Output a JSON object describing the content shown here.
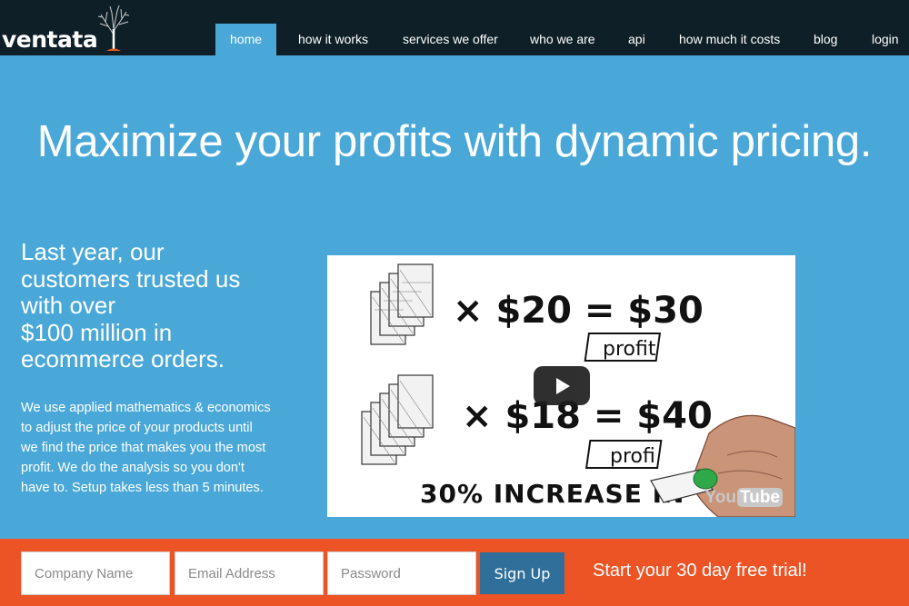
{
  "brand": {
    "name": "ventata"
  },
  "nav": {
    "items": [
      {
        "label": "home",
        "active": true
      },
      {
        "label": "how it works"
      },
      {
        "label": "services we offer"
      },
      {
        "label": "who we are"
      },
      {
        "label": "api"
      },
      {
        "label": "how much it costs"
      },
      {
        "label": "blog"
      },
      {
        "label": "login"
      }
    ]
  },
  "hero": {
    "headline": "Maximize your profits with dynamic pricing.",
    "stat_lines": [
      "Last year, our",
      "customers trusted us",
      "with over",
      "$100 million in",
      "ecommerce orders."
    ],
    "description": "We use applied mathematics & economics to adjust the price of your products until we find the price that makes you the most profit. We do the analysis so you don't have to. Setup takes less than 5 minutes."
  },
  "video": {
    "line1_mult": "× $20 = $30",
    "line1_label": "profit",
    "line2_mult": "× $18 = $40",
    "line2_label": "profi",
    "bottom_text": "30% INCREASE IN",
    "yt_you": "You",
    "yt_tube": "Tube",
    "play_icon": "play-icon"
  },
  "signup": {
    "company_placeholder": "Company Name",
    "email_placeholder": "Email Address",
    "password_placeholder": "Password",
    "button_label": "Sign Up",
    "cta": "Start your 30 day free trial!"
  },
  "colors": {
    "nav_bg": "#0f1f28",
    "hero_bg": "#4aa8d8",
    "signup_bg": "#ec5325",
    "button_bg": "#2f6f9a"
  }
}
